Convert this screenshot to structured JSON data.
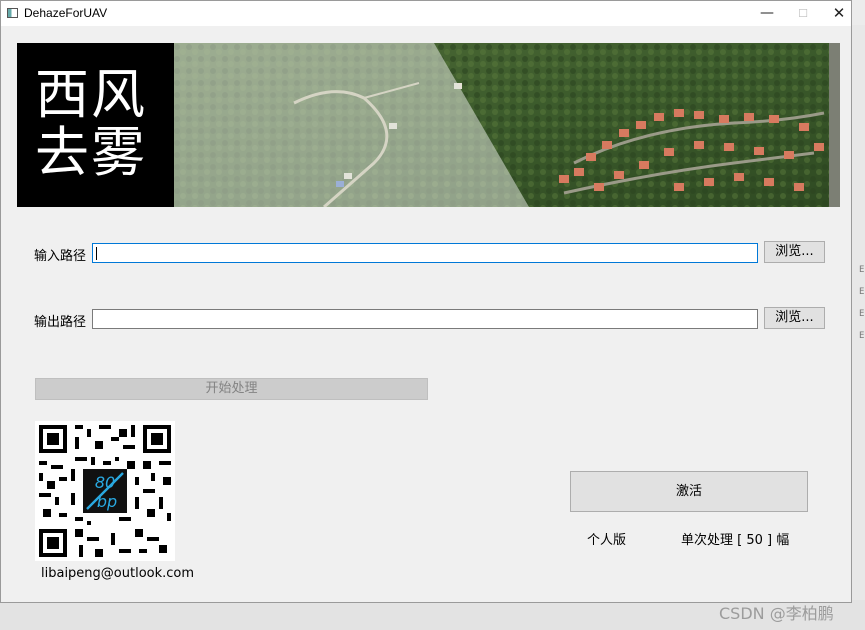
{
  "window": {
    "title": "DehazeForUAV",
    "minimize_glyph": "—",
    "maximize_glyph": "☐",
    "close_glyph": "✕"
  },
  "banner": {
    "logo_line1": "西风",
    "logo_line2": "去雾"
  },
  "form": {
    "input_label": "输入路径",
    "input_value": "",
    "output_label": "输出路径",
    "output_value": "",
    "browse_label": "浏览...",
    "start_label": "开始处理"
  },
  "contact": {
    "qr_center_top": "80",
    "qr_center_bottom": "bp",
    "email": "libaipeng@outlook.com"
  },
  "license": {
    "activate_label": "激活",
    "edition": "个人版",
    "quota": "单次处理 [ 50 ] 幅"
  },
  "watermark": "CSDN @李柏鹏",
  "colors": {
    "focus_border": "#0078d7",
    "logo_bg": "#000000",
    "button_bg": "#e1e1e1",
    "disabled_button_bg": "#cccccc"
  }
}
